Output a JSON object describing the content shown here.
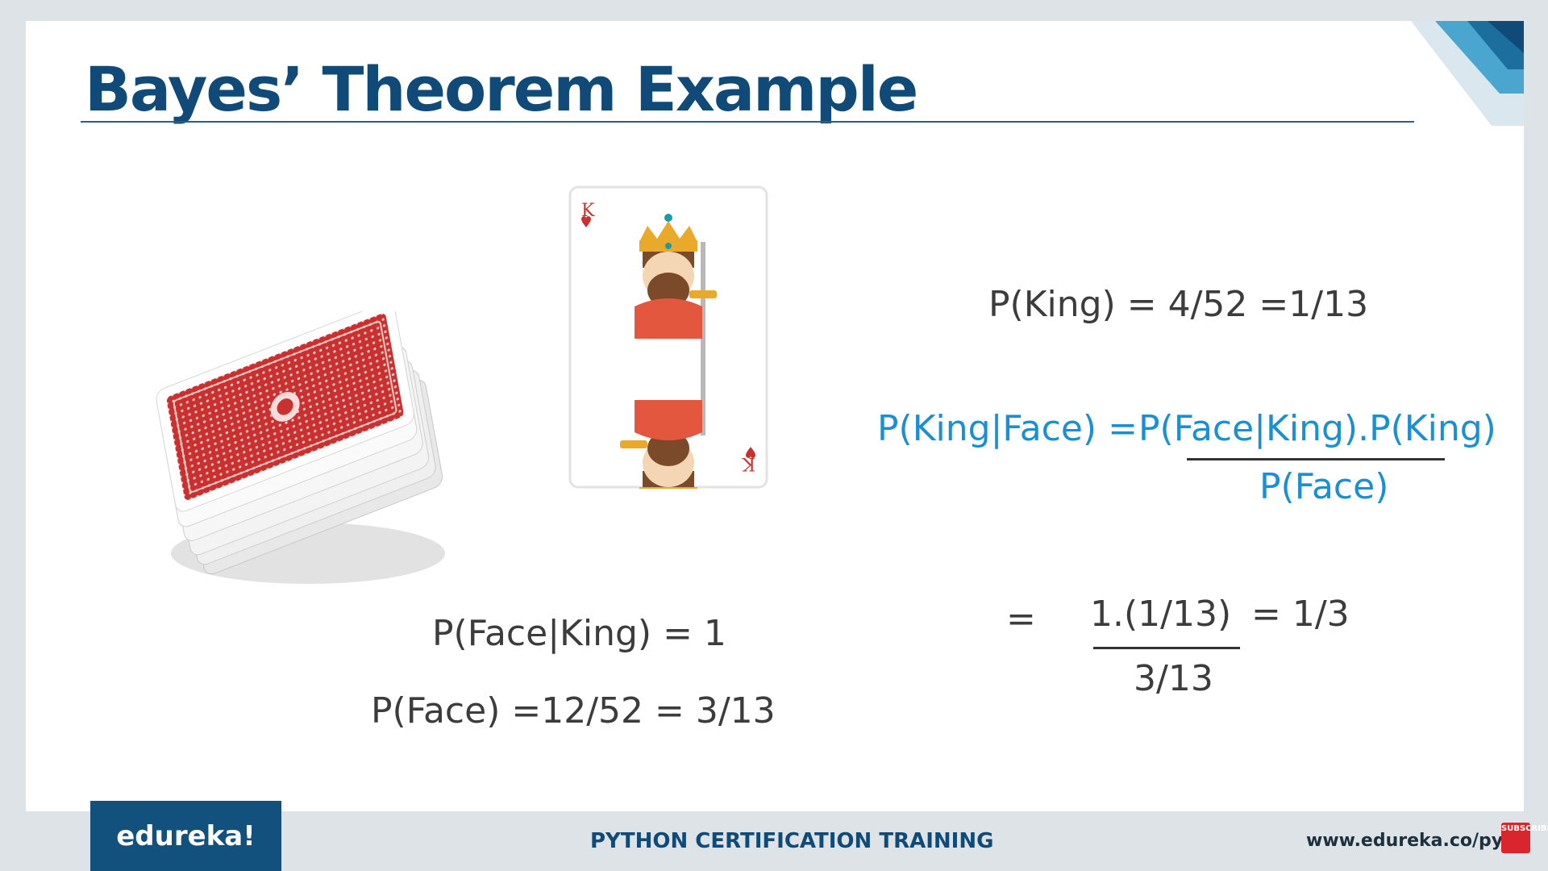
{
  "slide": {
    "title": "Bayes’ Theorem Example",
    "p_king": "P(King) = 4/52 =1/13",
    "bayes_left": "P(King|Face) =",
    "bayes_numerator": "P(Face|King).P(King)",
    "bayes_denominator": "P(Face)",
    "p_face_given_king": "P(Face|King) = 1",
    "p_face": "P(Face) =12/52 = 3/13",
    "result_equals": "=",
    "result_numerator": "1.(1/13)",
    "result_value": "= 1/3",
    "result_denominator": "3/13"
  },
  "footer": {
    "logo": "edureka!",
    "course_title": "PYTHON CERTIFICATION TRAINING",
    "url": "www.edureka.co/pytho",
    "subscribe_badge": "SUBSCRIBE"
  },
  "colors": {
    "title": "#0f4a78",
    "formula_dark": "#3c3c3c",
    "formula_blue": "#1a8fd4",
    "logo_bg": "#12517d",
    "card_red": "#c8312f"
  },
  "icons": [
    "card-deck-image",
    "king-of-hearts-card",
    "corner-decoration",
    "subscribe-badge-icon"
  ]
}
